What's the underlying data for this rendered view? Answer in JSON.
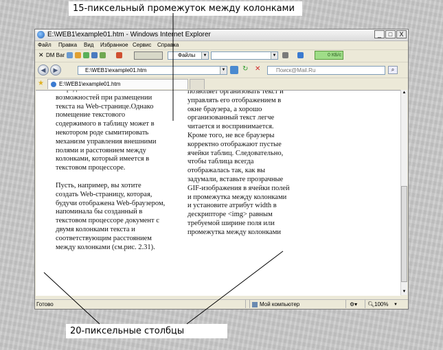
{
  "captions": {
    "top": "15-пиксельный промежуток между колонками",
    "bottom": "20-пиксельные столбцы"
  },
  "window": {
    "title": "E:\\WEB1\\example01.htm - Windows Internet Explorer",
    "buttons": {
      "minimize": "_",
      "maximize": "□",
      "close": "X"
    }
  },
  "menu": [
    "Файл",
    "Правка",
    "Вид",
    "Избранное",
    "Сервис",
    "Справка"
  ],
  "toolbar": {
    "dm_bar": "DM Bar",
    "files_combo": "Файлы",
    "speed": "0 КБ/с"
  },
  "address": {
    "url": "E:\\WEB1\\example01.htm",
    "search_placeholder": "Поиск@Mail.Ru"
  },
  "tab": {
    "label": "E:\\WEB1\\example01.htm"
  },
  "content": {
    "col1_p1": "непредоставляет таких же возможностей при размещении текста на Web-странице.Однако помещение текстового содержимого в таблицу может в некотором роде сымитировать механизм управления внешними полями и расстоянием между колонками, который имеется в текстовом процессоре.",
    "col1_p2": "Пусть, например, вы хотите создать Web-страницу, которая, будучи отображена Web-браузером, напоминала бы созданный в текстовом процессоре документ с двумя колонками текста и соответствующим расстоянием между колонками (см.рис. 2.31).",
    "col2_p1": "позволяет организовать текст и управлять его отображением в окне браузера, а хорошо организованный текст легче читается и воспринимается. Кроме того, не все браузеры корректно отображают пустые ячейки таблиц. Следовательно, чтобы таблица всегда отображалась так, как вы задумали, вставьте прозрачные GIF-изображения в ячейки полей и промежутка между колонками и установите атрибут width в дескрипторе <img> равным требуемой ширине поля или промежутка между колонками"
  },
  "status": {
    "ready": "Готово",
    "zone": "Мой компьютер",
    "zoom": "100%"
  }
}
